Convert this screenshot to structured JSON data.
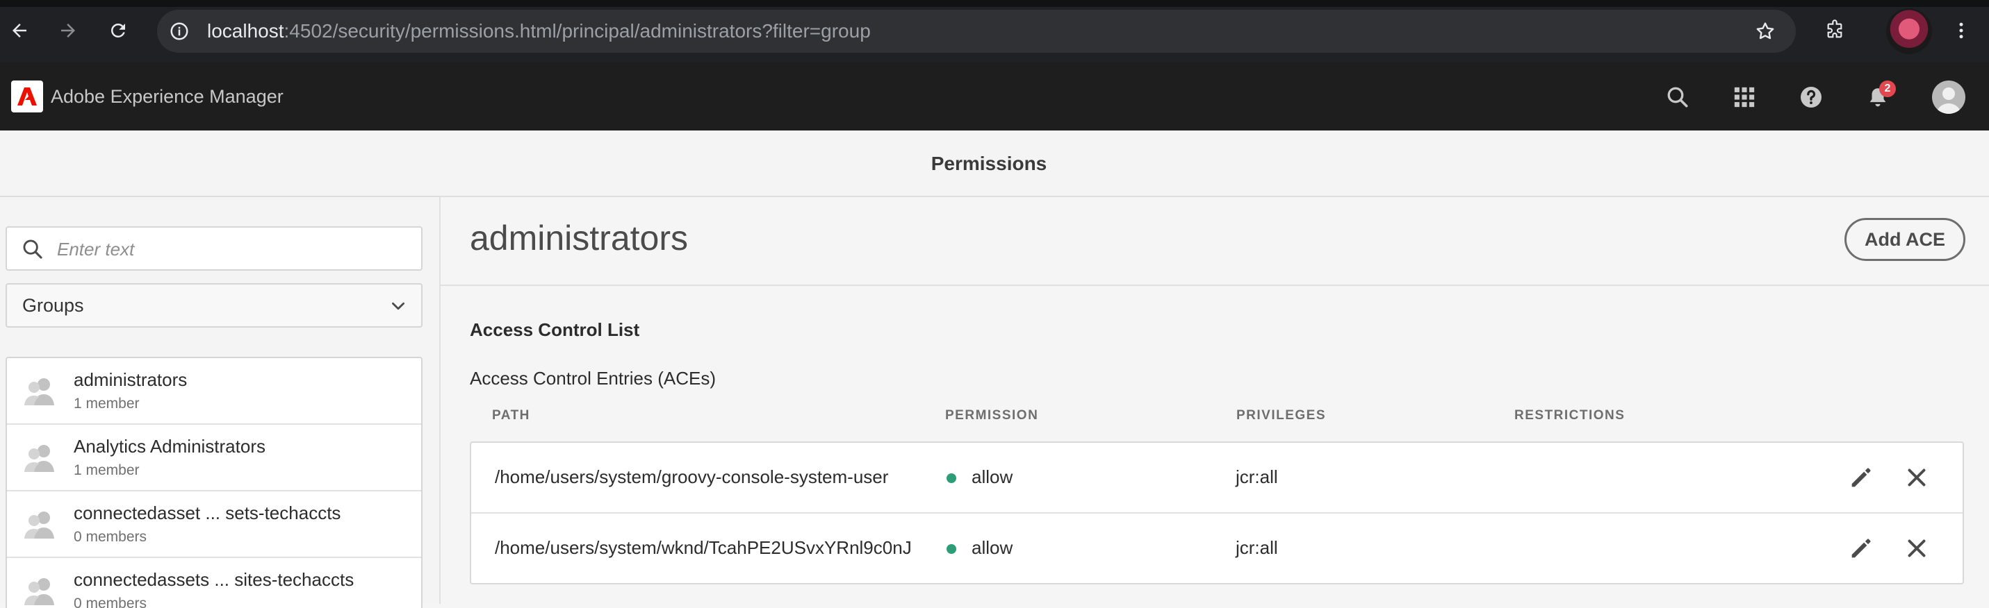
{
  "browser": {
    "url_host": "localhost",
    "url_rest": ":4502/security/permissions.html/principal/administrators?filter=group"
  },
  "shell": {
    "app_title": "Adobe Experience Manager",
    "notification_count": "2"
  },
  "page": {
    "title": "Permissions"
  },
  "rail": {
    "search_placeholder": "Enter text",
    "filter_selected": "Groups",
    "groups": [
      {
        "name": "administrators",
        "members": "1 member"
      },
      {
        "name": "Analytics Administrators",
        "members": "1 member"
      },
      {
        "name": "connectedasset ... sets-techaccts",
        "members": "0 members"
      },
      {
        "name": "connectedassets ... sites-techaccts",
        "members": "0 members"
      }
    ]
  },
  "main": {
    "principal": "administrators",
    "add_ace_label": "Add ACE",
    "acl_heading": "Access Control List",
    "aces_heading": "Access Control Entries (ACEs)",
    "columns": {
      "path": "PATH",
      "permission": "PERMISSION",
      "privileges": "PRIVILEGES",
      "restrictions": "RESTRICTIONS"
    },
    "entries": [
      {
        "path": "/home/users/system/groovy-console-system-user",
        "permission": "allow",
        "privileges": "jcr:all",
        "restrictions": ""
      },
      {
        "path": "/home/users/system/wknd/TcahPE2USvxYRnl9c0nJ",
        "permission": "allow",
        "privileges": "jcr:all",
        "restrictions": ""
      }
    ]
  },
  "colors": {
    "allow_dot": "#2d9d78",
    "shell_bg": "#1e1e1e",
    "badge": "#e34850",
    "adobe_red": "#eb1000"
  },
  "icons": [
    "back-icon",
    "forward-icon",
    "reload-icon",
    "site-info-icon",
    "star-icon",
    "extensions-icon",
    "more-icon",
    "adobe-logo-icon",
    "search-icon",
    "apps-grid-icon",
    "help-icon",
    "bell-icon",
    "user-icon",
    "chevron-down-icon",
    "group-icon",
    "edit-icon",
    "close-icon"
  ]
}
